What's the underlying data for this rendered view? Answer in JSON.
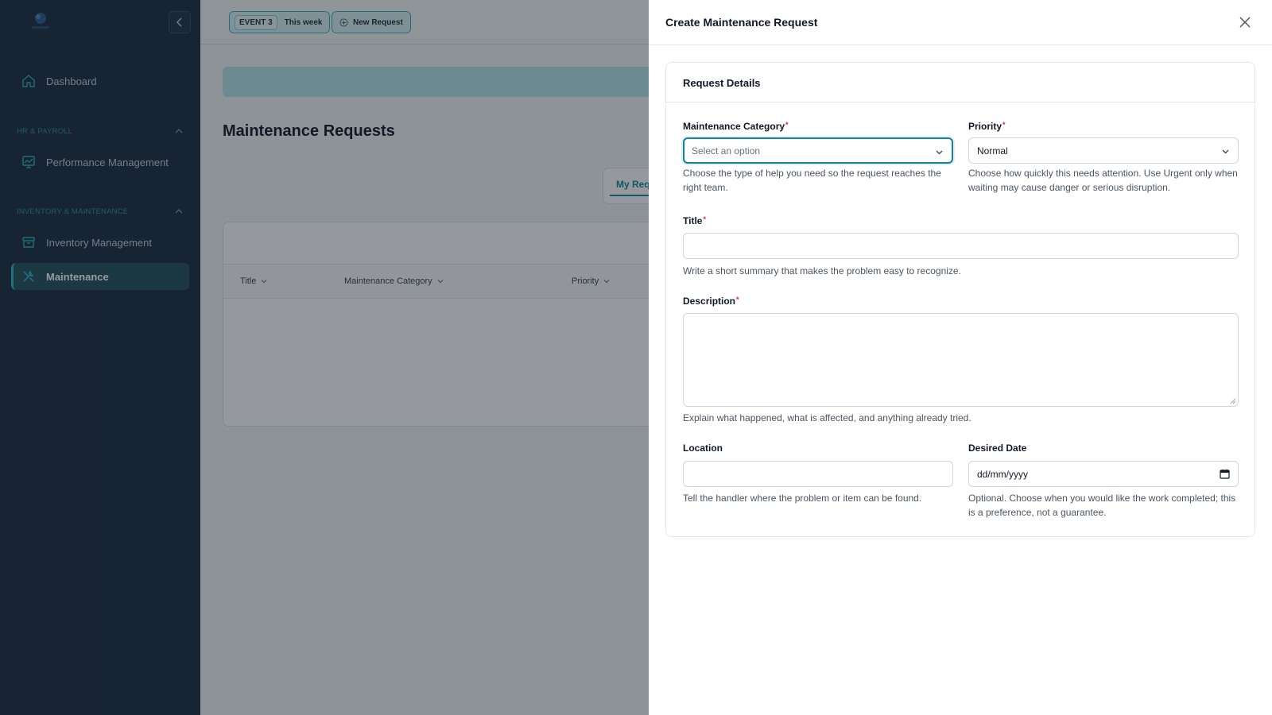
{
  "sidebar": {
    "items": [
      {
        "label": "Dashboard",
        "icon": "home-icon"
      },
      {
        "label": "Performance Management",
        "icon": "chart-board-icon"
      },
      {
        "label": "Inventory Management",
        "icon": "archive-box-icon"
      },
      {
        "label": "Maintenance",
        "icon": "wrench-screwdriver-icon",
        "active": true
      }
    ],
    "sections": {
      "hr": "HR & PAYROLL",
      "inventory": "INVENTORY & MAINTENANCE"
    }
  },
  "topbar": {
    "event_badge": "EVENT 3",
    "event_period": "This week",
    "new_request": "New Request"
  },
  "main": {
    "title": "Maintenance Requests",
    "tab_my_requests": "My Req",
    "columns": [
      "Title",
      "Maintenance Category",
      "Priority"
    ]
  },
  "drawer": {
    "title": "Create Maintenance Request",
    "section_title": "Request Details",
    "fields": {
      "category": {
        "label": "Maintenance Category",
        "placeholder": "Select an option",
        "hint": "Choose the type of help you need so the request reaches the right team."
      },
      "priority": {
        "label": "Priority",
        "value": "Normal",
        "hint": "Choose how quickly this needs attention. Use Urgent only when waiting may cause danger or serious disruption."
      },
      "title": {
        "label": "Title",
        "value": "",
        "hint": "Write a short summary that makes the problem easy to recognize."
      },
      "description": {
        "label": "Description",
        "value": "",
        "hint": "Explain what happened, what is affected, and anything already tried."
      },
      "location": {
        "label": "Location",
        "value": "",
        "hint": "Tell the handler where the problem or item can be found."
      },
      "desired_date": {
        "label": "Desired Date",
        "placeholder": "dd/mm/yyyy",
        "hint": "Optional. Choose when you would like the work completed; this is a preference, not a guarantee."
      }
    }
  },
  "colors": {
    "sidebar_bg": "#1b2b40",
    "accent": "#14829a",
    "required": "#e11d48"
  }
}
